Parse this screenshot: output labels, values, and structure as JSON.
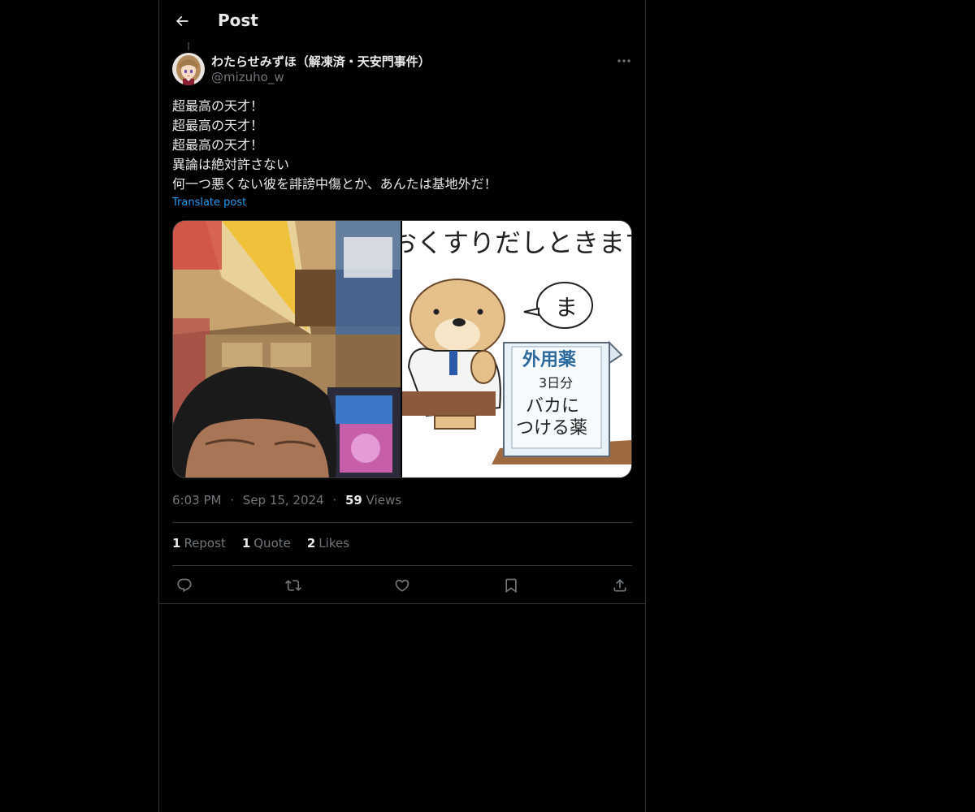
{
  "header": {
    "title": "Post",
    "back_icon": "arrow-left-icon"
  },
  "author": {
    "display_name": "わたらせみずほ（解凍済・天安門事件）",
    "handle": "@mizuho_w"
  },
  "post": {
    "lines": [
      "超最高の天才！",
      "超最高の天才！",
      "超最高の天才！",
      "異論は絶対許さない",
      "何一つ悪くない彼を誹謗中傷とか、あんたは基地外だ！"
    ],
    "translate_label": "Translate post"
  },
  "media": {
    "right_image": {
      "top_text": "おくすりだしときますね",
      "speech": "ま",
      "bag_title": "外用薬",
      "bag_dose": "3日分",
      "bag_line1": "バカに",
      "bag_line2": "つける薬"
    }
  },
  "meta": {
    "time": "6:03 PM",
    "date": "Sep 15, 2024",
    "views_count": "59",
    "views_label": "Views",
    "separator": "·"
  },
  "stats": {
    "reposts_count": "1",
    "reposts_label": "Repost",
    "quotes_count": "1",
    "quotes_label": "Quote",
    "likes_count": "2",
    "likes_label": "Likes"
  },
  "colors": {
    "background": "#000000",
    "text": "#e7e9ea",
    "secondary": "#71767b",
    "accent": "#1d9bf0",
    "border": "#2f3336"
  },
  "icons": [
    "arrow-left-icon",
    "more-icon",
    "reply-icon",
    "repost-icon",
    "like-icon",
    "bookmark-icon",
    "share-icon"
  ]
}
